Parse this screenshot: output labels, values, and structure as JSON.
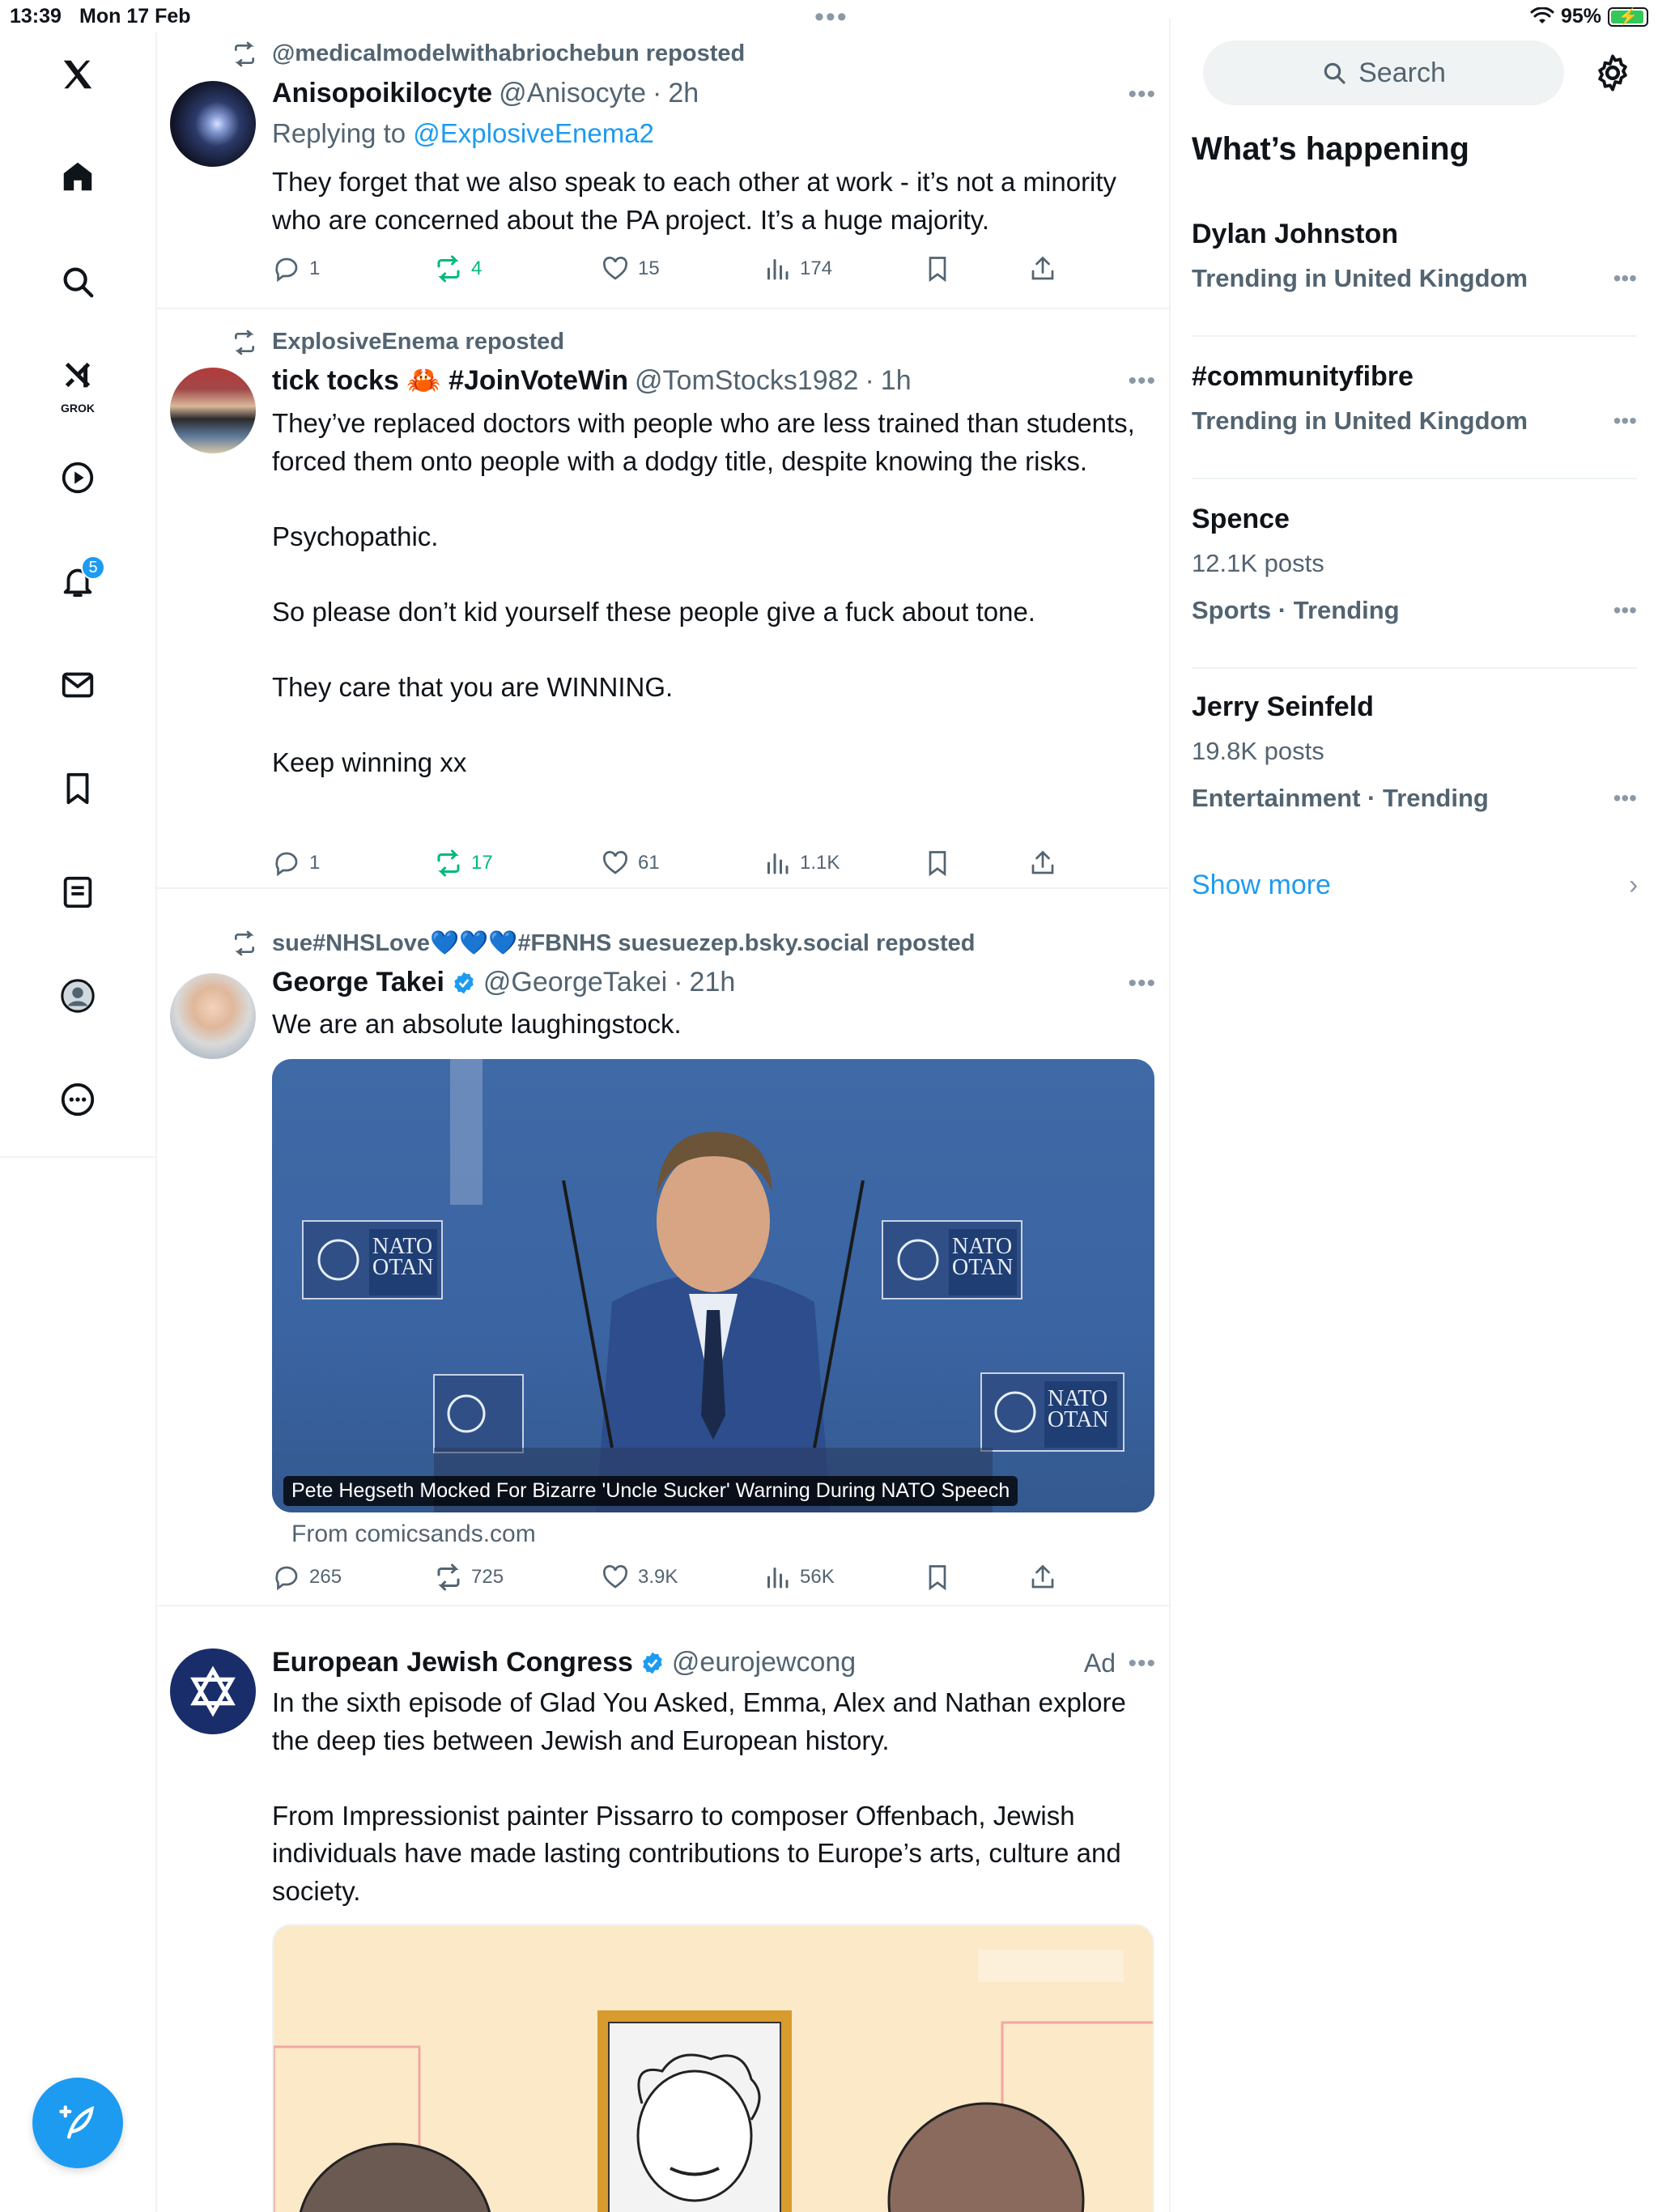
{
  "status_bar": {
    "time": "13:39",
    "date": "Mon 17 Feb",
    "battery": "95%",
    "battery_level": 0.95
  },
  "nav": {
    "notifications_badge": "5",
    "grok_label": "GROK"
  },
  "colors": {
    "accent": "#1d9bf0",
    "repost_green": "#00ba7c",
    "muted": "#536471"
  },
  "posts": [
    {
      "repost_by": "@medicalmodelwithabriochebun reposted",
      "name": "Anisopoikilocyte",
      "handle": "@Anisocyte",
      "time": "2h",
      "reply_prefix": "Replying to ",
      "reply_to": "@ExplosiveEnema2",
      "text": "They forget that we also speak to each other at work - it’s not a minority who are concerned about the PA project. It’s a huge majority.",
      "replies": "1",
      "reposts": "4",
      "likes": "15",
      "views": "174"
    },
    {
      "repost_by": "ExplosiveEnema reposted",
      "name": "tick tocks 🦀 #JoinVoteWin",
      "handle": "@TomStocks1982",
      "time": "1h",
      "text": "They’ve replaced doctors with people who are less trained than students, forced them onto people with a dodgy title, despite knowing the risks.\n\nPsychopathic.\n\nSo please don’t kid yourself these people give a fuck about tone.\n\nThey care that you are WINNING.\n\nKeep winning xx",
      "replies": "1",
      "reposts": "17",
      "likes": "61",
      "views": "1.1K"
    },
    {
      "repost_by": "sue#NHSLove💙💙💙#FBNHS suesuezep.bsky.social reposted",
      "name": "George Takei",
      "handle": "@GeorgeTakei",
      "time": "21h",
      "text": "We are an absolute laughingstock.",
      "media_caption": "Pete Hegseth Mocked For Bizarre 'Uncle Sucker' Warning During NATO Speech",
      "media_sign": "NATO",
      "media_sign2": "OTAN",
      "from": "From comicsands.com",
      "replies": "265",
      "reposts": "725",
      "likes": "3.9K",
      "views": "56K"
    },
    {
      "name": "European Jewish Congress",
      "handle": "@eurojewcong",
      "ad_label": "Ad",
      "text": "In the sixth episode of Glad You Asked, Emma, Alex and Nathan explore the deep ties between Jewish and European history.\n\nFrom Impressionist painter Pissarro to composer Offenbach, Jewish individuals have made lasting contributions to Europe’s arts, culture and society."
    }
  ],
  "sidebar": {
    "search_placeholder": "Search",
    "heading": "What’s happening",
    "trends": [
      {
        "title": "Dylan Johnston",
        "meta": "Trending in United Kingdom"
      },
      {
        "title": "#communityfibre",
        "meta": "Trending in United Kingdom"
      },
      {
        "title": "Spence",
        "count": "12.1K posts",
        "meta": "Sports · Trending"
      },
      {
        "title": "Jerry Seinfeld",
        "count": "19.8K posts",
        "meta": "Entertainment · Trending"
      }
    ],
    "show_more": "Show more"
  }
}
